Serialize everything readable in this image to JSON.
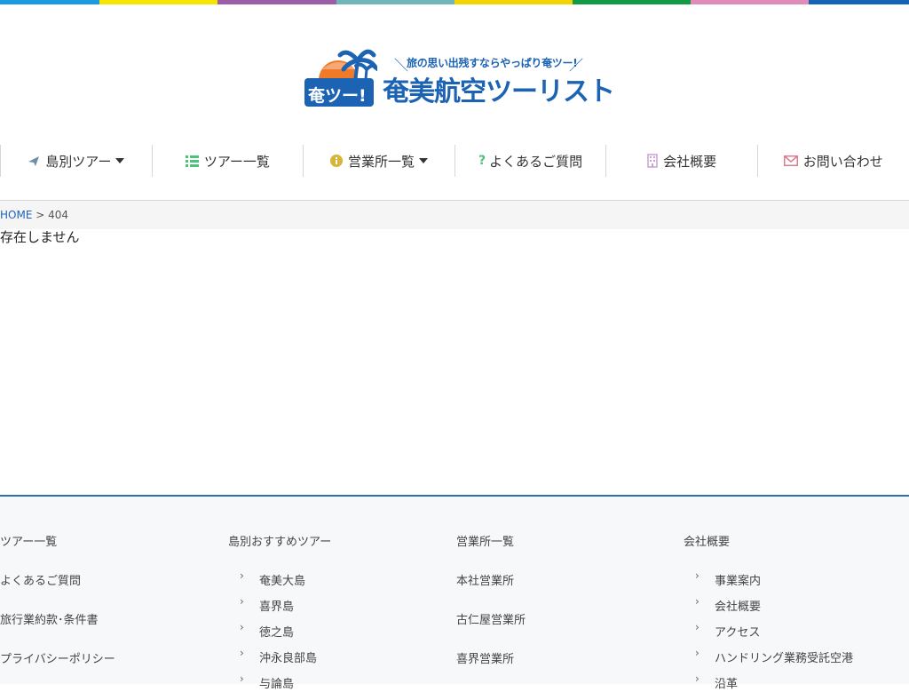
{
  "colors": {
    "stripe": [
      "#1a9be0",
      "#f5e600",
      "#9a5fa6",
      "#6fb6b8",
      "#f2d400",
      "#129a45",
      "#e08bb8",
      "#1466b4"
    ],
    "brand": "#1d63b3",
    "footer_border": "#2f6fae"
  },
  "logo": {
    "tagline": "旅の思い出残すならやっぱり奄ツー!",
    "name": "奄美航空ツーリスト",
    "badge": "奄ツー!"
  },
  "nav": {
    "items": [
      {
        "label": "島別ツアー",
        "icon": "airplane-icon",
        "dropdown": true
      },
      {
        "label": "ツアー一覧",
        "icon": "list-icon",
        "dropdown": false
      },
      {
        "label": "営業所一覧",
        "icon": "info-icon",
        "dropdown": true
      },
      {
        "label": "よくあるご質問",
        "icon": "question-icon",
        "dropdown": false
      },
      {
        "label": "会社概要",
        "icon": "building-icon",
        "dropdown": false
      },
      {
        "label": "お問い合わせ",
        "icon": "envelope-icon",
        "dropdown": false
      }
    ]
  },
  "breadcrumb": {
    "home": "HOME",
    "sep": ">",
    "current": "404"
  },
  "content": {
    "message": "存在しません"
  },
  "footer": {
    "col1": {
      "head": "ツアー一覧",
      "links": [
        "よくあるご質問",
        "旅行業約款･条件書",
        "プライバシーポリシー"
      ]
    },
    "col2": {
      "head": "島別おすすめツアー",
      "items": [
        "奄美大島",
        "喜界島",
        "徳之島",
        "沖永良部島",
        "与論島"
      ]
    },
    "col3": {
      "head": "営業所一覧",
      "links": [
        "本社営業所",
        "古仁屋営業所",
        "喜界営業所"
      ]
    },
    "col4": {
      "head": "会社概要",
      "items": [
        "事業案内",
        "会社概要",
        "アクセス",
        "ハンドリング業務受託空港",
        "沿革"
      ]
    }
  }
}
